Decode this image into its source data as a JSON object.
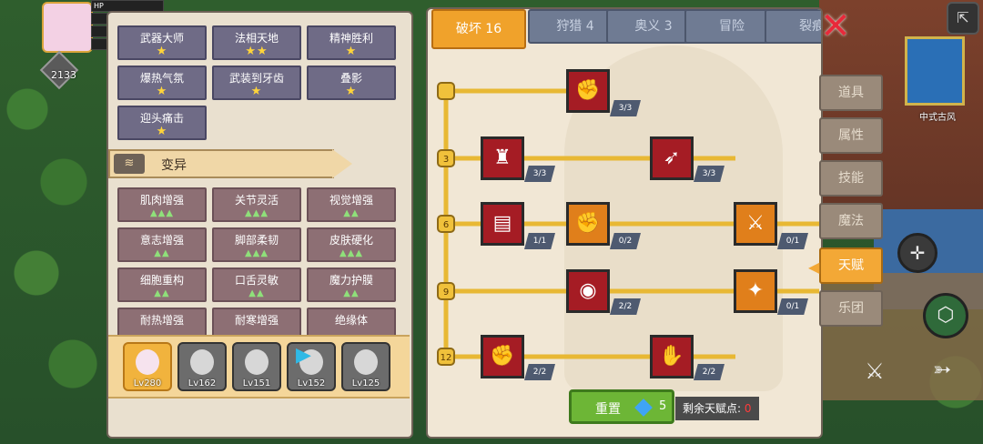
{
  "hud": {
    "level": "2133",
    "stats": [
      "HP",
      "",
      "",
      ""
    ]
  },
  "left_panel": {
    "top_skills": [
      {
        "name": "武器大师",
        "stars": "★"
      },
      {
        "name": "法相天地",
        "stars": "★★"
      },
      {
        "name": "精神胜利",
        "stars": "★"
      },
      {
        "name": "爆热气氛",
        "stars": "★"
      },
      {
        "name": "武装到牙齿",
        "stars": "★"
      },
      {
        "name": "叠影",
        "stars": "★"
      },
      {
        "name": "迎头痛击",
        "stars": "★"
      }
    ],
    "section_title": "变异",
    "section_icon": "dna-icon",
    "mutations": [
      {
        "name": "肌肉增强",
        "marks": "▲▲▲"
      },
      {
        "name": "关节灵活",
        "marks": "▲▲▲"
      },
      {
        "name": "视觉增强",
        "marks": "▲▲"
      },
      {
        "name": "意志增强",
        "marks": "▲▲"
      },
      {
        "name": "脚部柔韧",
        "marks": "▲▲▲"
      },
      {
        "name": "皮肤硬化",
        "marks": "▲▲▲"
      },
      {
        "name": "细胞重构",
        "marks": "▲▲"
      },
      {
        "name": "口舌灵敏",
        "marks": "▲▲"
      },
      {
        "name": "魔力护膜",
        "marks": "▲▲"
      },
      {
        "name": "耐热增强",
        "marks": ""
      },
      {
        "name": "耐寒增强",
        "marks": ""
      },
      {
        "name": "绝缘体",
        "marks": ""
      }
    ],
    "heroes": [
      {
        "level": "Lv280"
      },
      {
        "level": "Lv162"
      },
      {
        "level": "Lv151"
      },
      {
        "level": "Lv152"
      },
      {
        "level": "Lv125"
      }
    ]
  },
  "tabs": [
    {
      "label": "破坏 16"
    },
    {
      "label": "狩猎 4"
    },
    {
      "label": "奥义 3"
    },
    {
      "label": "冒险"
    },
    {
      "label": "裂痕"
    }
  ],
  "tree": {
    "levels": [
      "3",
      "6",
      "9",
      "12"
    ],
    "nodes": [
      {
        "icon": "arm-wrestle-icon",
        "glyph": "✊",
        "count": "3/3"
      },
      {
        "icon": "body-icon",
        "glyph": "♜",
        "count": "3/3"
      },
      {
        "icon": "arrow-hit-icon",
        "glyph": "➶",
        "count": "3/3"
      },
      {
        "icon": "card-icon",
        "glyph": "▤",
        "count": "1/1"
      },
      {
        "icon": "punch-icon",
        "glyph": "✊",
        "count": "0/2"
      },
      {
        "icon": "sword-strike-icon",
        "glyph": "⚔",
        "count": "0/1"
      },
      {
        "icon": "shockwave-icon",
        "glyph": "◉",
        "count": "2/2"
      },
      {
        "icon": "bat-wing-icon",
        "glyph": "✦",
        "count": "0/1"
      },
      {
        "icon": "fist-icon",
        "glyph": "✊",
        "count": "2/2"
      },
      {
        "icon": "fist-burst-icon",
        "glyph": "✋",
        "count": "2/2"
      }
    ]
  },
  "reset": {
    "label": "重置",
    "cost": "5"
  },
  "remaining": {
    "label": "剩余天赋点:",
    "value": "0"
  },
  "side_tabs": [
    {
      "label": "道具"
    },
    {
      "label": "属性"
    },
    {
      "label": "技能"
    },
    {
      "label": "魔法"
    },
    {
      "label": "天赋"
    },
    {
      "label": "乐团"
    }
  ],
  "right_hud": {
    "location": "中式古风"
  },
  "colors": {
    "active_tab": "#f0a22b",
    "node_red": "#a51c24",
    "node_orange": "#e07f1b",
    "close": "#e8293a",
    "reset": "#6db636"
  }
}
